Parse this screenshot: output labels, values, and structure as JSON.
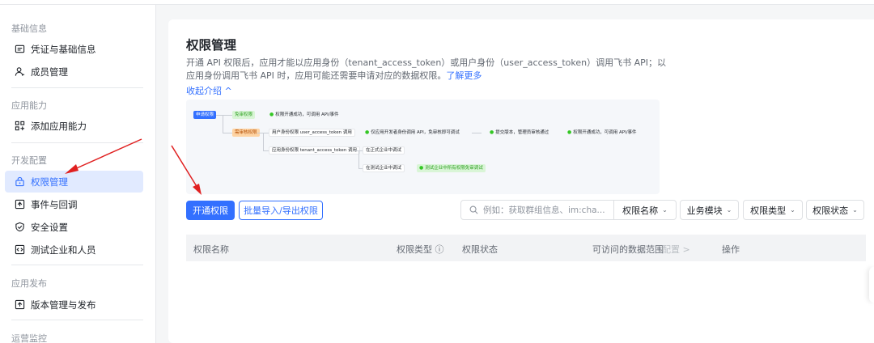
{
  "sidebar": {
    "sections": [
      {
        "title": "基础信息",
        "items": [
          {
            "label": "凭证与基础信息",
            "icon": "id-card-icon"
          },
          {
            "label": "成员管理",
            "icon": "user-icon"
          }
        ]
      },
      {
        "title": "应用能力",
        "items": [
          {
            "label": "添加应用能力",
            "icon": "grid-plus-icon"
          }
        ]
      },
      {
        "title": "开发配置",
        "items": [
          {
            "label": "权限管理",
            "icon": "lock-icon",
            "active": true
          },
          {
            "label": "事件与回调",
            "icon": "event-icon"
          },
          {
            "label": "安全设置",
            "icon": "shield-icon"
          },
          {
            "label": "测试企业和人员",
            "icon": "test-icon"
          }
        ]
      },
      {
        "title": "应用发布",
        "items": [
          {
            "label": "版本管理与发布",
            "icon": "upload-icon"
          }
        ]
      },
      {
        "title": "运营监控",
        "items": []
      }
    ]
  },
  "main": {
    "title": "权限管理",
    "desc_text": "开通 API 权限后，应用才能以应用身份（tenant_access_token）或用户身份（user_access_token）调用飞书 API；以应用身份调用飞书 API 时，应用可能还需要申请对应的数据权限。",
    "desc_link": "了解更多",
    "collapse": "收起介绍 ^",
    "flow": {
      "apply": "申请权限",
      "free": "免审权限",
      "free_result": "权限开通成功，可调用 API/事件",
      "review": "需审核权限",
      "user_identity": "用户身份权限 user_access_token 调用",
      "dev_only": "仅应用开发者身份调用 API，免审核即可调试",
      "submit": "提交版本，管理员审核通过",
      "review_result": "权限开通成功，可调用 API/事件",
      "app_identity": "应用身份权限 tenant_access_token 调用",
      "formal": "在正式企业中调试",
      "test": "在测试企业中调试",
      "test_result": "测试企业中所有权限免审调试"
    },
    "toolbar": {
      "open_button": "开通权限",
      "batch_button": "批量导入/导出权限",
      "search_placeholder": "例如：获取群组信息、im:cha...",
      "filter_name": "权限名称",
      "filter_module": "业务模块",
      "filter_type": "权限类型",
      "filter_status": "权限状态"
    },
    "table": {
      "col_name": "权限名称",
      "col_type": "权限类型 ⓘ",
      "col_status": "权限状态",
      "col_scope": "可访问的数据范围",
      "col_scope_config": "配置 >",
      "col_actions": "操作"
    }
  },
  "colors": {
    "accent": "#3370ff",
    "annotation": "#e02020"
  }
}
